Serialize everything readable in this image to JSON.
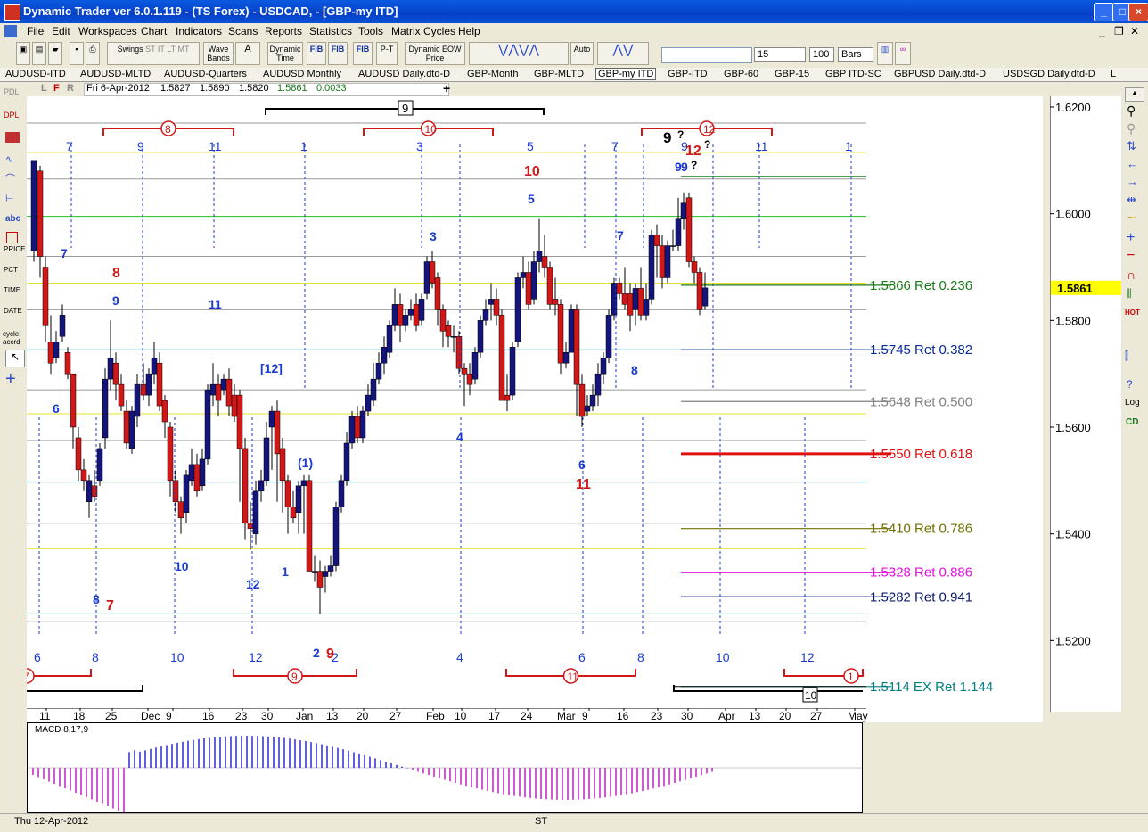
{
  "window": {
    "title": "Dynamic Trader ver 6.0.1.119 - (TS Forex) - USDCAD, - [GBP-my ITD]",
    "min_icon": "minimize-icon",
    "max_icon": "maximize-icon",
    "close_icon": "close-icon"
  },
  "menu": [
    "File",
    "Edit",
    "Workspaces",
    "Chart",
    "Indicators",
    "Scans",
    "Reports",
    "Statistics",
    "Tools",
    "Matrix Cycles",
    "Help"
  ],
  "toolbar": {
    "swings": "Swings",
    "swings_sub": "ST IT LT MT",
    "wave_bands": "Wave Bands",
    "a_label": "A",
    "dynamic_time": "Dynamic Time",
    "fib_t1": "FIB",
    "fib_t2": "FIB",
    "fib_t3": "FIB",
    "pt": "P-T",
    "dynamic_eow": "Dynamic EOW",
    "price": "Price",
    "auto": "Auto",
    "interval_value": "15",
    "bars_count": "100",
    "bars_unit": "Bars"
  },
  "tabs": [
    "AUDUSD-ITD",
    "AUDUSD-MLTD",
    "AUDUSD-Quarters",
    "AUDUSD  Monthly",
    "AUDUSD  Daily.dtd-D",
    "GBP-Month",
    "GBP-MLTD",
    "GBP-my ITD",
    "GBP-ITD",
    "GBP-60",
    "GBP-15",
    "GBP ITD-SC",
    "GBPUSD  Daily.dtd-D",
    "USDSGD  Daily.dtd-D",
    "L"
  ],
  "active_tab": "GBP-my ITD",
  "infobar": {
    "letters": [
      "L",
      "F",
      "R"
    ],
    "date": "Fri 6-Apr-2012",
    "open": "1.5827",
    "high": "1.5890",
    "low": "1.5820",
    "close": "1.5861",
    "change": "0.0033"
  },
  "left_tools": [
    "PDL",
    "DPL",
    "abc",
    "PRICE",
    "PCT",
    "TIME",
    "DATE",
    "cycle accrd"
  ],
  "right_tools": [
    "HOT",
    "Log",
    "CD"
  ],
  "price_axis": {
    "ticks": [
      "1.6200",
      "1.6000",
      "1.5800",
      "1.5600",
      "1.5400",
      "1.5200"
    ],
    "current": "1.5861"
  },
  "date_axis": [
    "11",
    "18",
    "25",
    "Dec",
    "9",
    "16",
    "23",
    "30",
    "Jan",
    "13",
    "20",
    "27",
    "Feb",
    "10",
    "17",
    "24",
    "Mar",
    "9",
    "16",
    "23",
    "30",
    "Apr",
    "13",
    "20",
    "27",
    "May"
  ],
  "retracements": [
    {
      "label": "1.5866 Ret 0.236",
      "color": "#1a7a1a"
    },
    {
      "label": "1.5745 Ret 0.382",
      "color": "#0a2a9a"
    },
    {
      "label": "1.5648 Ret 0.500",
      "color": "#808080"
    },
    {
      "label": "1.5550 Ret 0.618",
      "color": "#e01010"
    },
    {
      "label": "1.5410 Ret 0.786",
      "color": "#707000"
    },
    {
      "label": "1.5328 Ret 0.886",
      "color": "#e010e0"
    },
    {
      "label": "1.5282 Ret 0.941",
      "color": "#0a1a6a"
    },
    {
      "label": "1.5114 EX Ret 1.144",
      "color": "#008080"
    }
  ],
  "cycle_top_blue": [
    "7",
    "9",
    "11",
    "1",
    "3",
    "5",
    "7",
    "9",
    "11",
    "1"
  ],
  "cycle_bottom_blue": [
    "6",
    "8",
    "10",
    "12",
    "2",
    "4",
    "6",
    "8",
    "10",
    "12"
  ],
  "bracket_top_red": [
    "8",
    "10",
    "12"
  ],
  "bracket_top_black": "9",
  "bracket_bottom_red": [
    "7",
    "9",
    "11",
    "1"
  ],
  "bracket_bottom_black": "10",
  "wave_labels": {
    "blue": [
      "7",
      "9",
      "11",
      "[12]",
      "(1)",
      "1",
      "6",
      "10",
      "12",
      "8",
      "3",
      "4",
      "5",
      "7",
      "8",
      "6",
      "9",
      "2",
      "9"
    ],
    "red": [
      "8",
      "7",
      "10",
      "11",
      "12",
      "9"
    ],
    "black": [
      "9",
      "?",
      "?",
      "?"
    ]
  },
  "macd_label": "MACD 8,17,9",
  "chart_data": {
    "type": "candlestick",
    "symbol": "GBP",
    "ylim": [
      1.51,
      1.625
    ],
    "y_ticks": [
      1.62,
      1.6,
      1.58,
      1.56,
      1.54,
      1.52
    ],
    "x": [
      "11",
      "18",
      "25",
      "Dec",
      "9",
      "16",
      "23",
      "30",
      "Jan",
      "13",
      "20",
      "27",
      "Feb",
      "10",
      "17",
      "24",
      "Mar",
      "9",
      "16",
      "23",
      "30",
      "Apr",
      "13",
      "20",
      "27",
      "May"
    ],
    "last_bar": {
      "date": "Fri 6-Apr-2012",
      "open": 1.5827,
      "high": 1.589,
      "low": 1.582,
      "close": 1.5861
    },
    "retracement_levels": [
      1.5866,
      1.5745,
      1.5648,
      1.555,
      1.541,
      1.5328,
      1.5282,
      1.5114
    ],
    "retracement_ratios": [
      0.236,
      0.382,
      0.5,
      0.618,
      0.786,
      0.886,
      0.941,
      1.144
    ]
  },
  "status": {
    "left": "Thu 12-Apr-2012",
    "mid": "ST"
  }
}
